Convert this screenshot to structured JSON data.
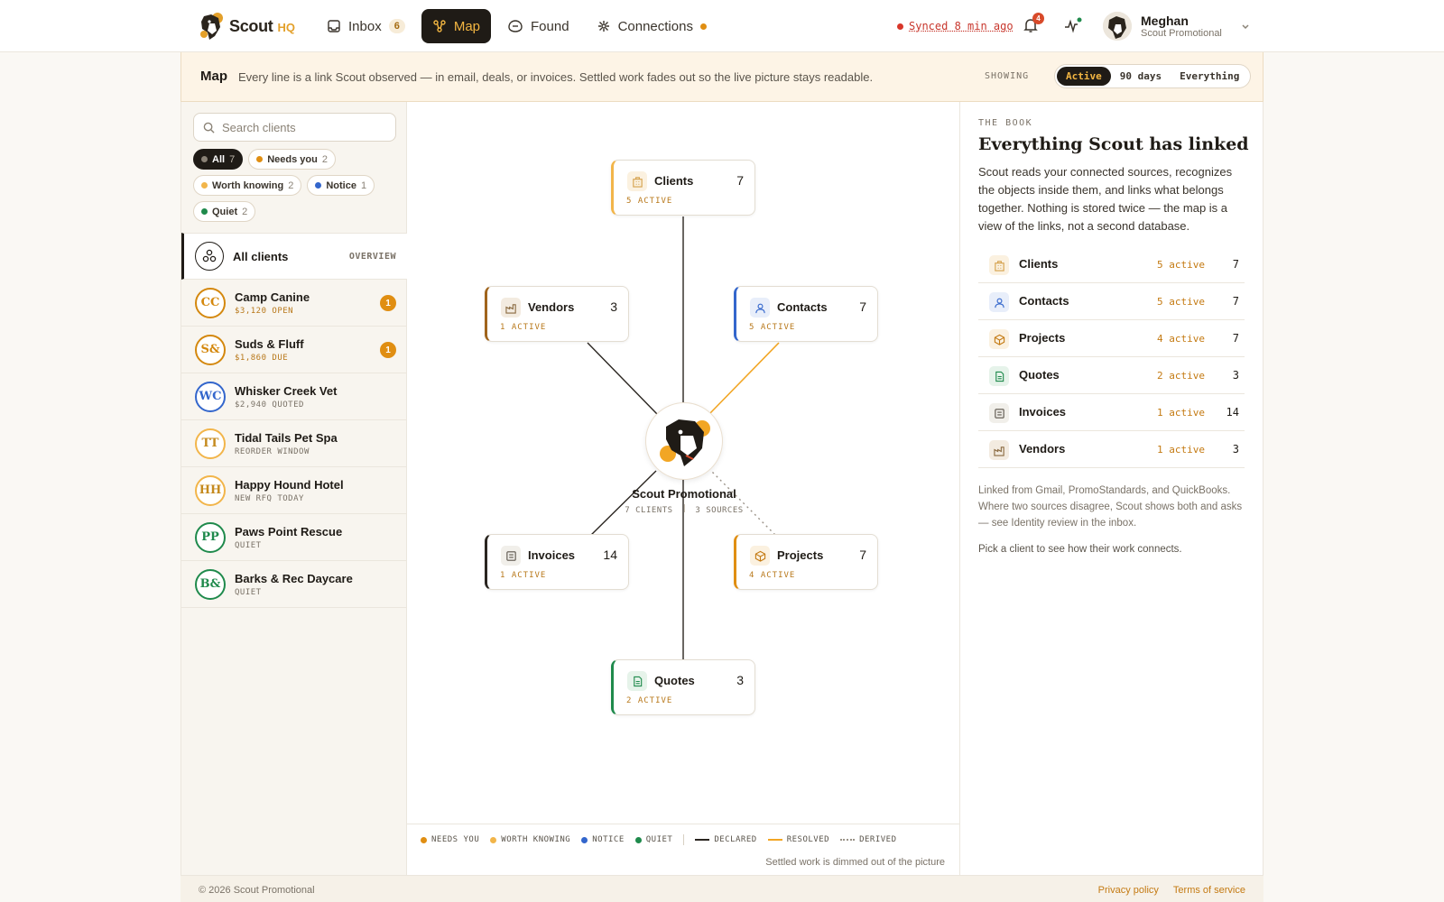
{
  "brand": {
    "name": "Scout",
    "suffix": "HQ"
  },
  "nav": {
    "inbox": {
      "label": "Inbox",
      "count": "6"
    },
    "map": {
      "label": "Map"
    },
    "found": {
      "label": "Found"
    },
    "connections": {
      "label": "Connections"
    }
  },
  "status": {
    "sync": "Synced 8 min ago",
    "notifications": "4"
  },
  "user": {
    "name": "Meghan",
    "org": "Scout Promotional"
  },
  "banner": {
    "title": "Map",
    "description": "Every line is a link Scout observed — in email, deals, or invoices. Settled work fades out so the live picture stays readable.",
    "showing_label": "SHOWING",
    "options": [
      "Active",
      "90 days",
      "Everything"
    ],
    "selected": "Active"
  },
  "sidebar": {
    "search_placeholder": "Search clients",
    "filters": [
      {
        "label": "All",
        "count": "7",
        "color": "#8a8276"
      },
      {
        "label": "Needs you",
        "count": "2",
        "color": "#e08e12"
      },
      {
        "label": "Worth knowing",
        "count": "2",
        "color": "#f2b54a"
      },
      {
        "label": "Notice",
        "count": "1",
        "color": "#3366cc"
      },
      {
        "label": "Quiet",
        "count": "2",
        "color": "#1f8a4c"
      }
    ],
    "all_clients": {
      "label": "All clients",
      "tag": "OVERVIEW"
    },
    "clients": [
      {
        "initials": "CC",
        "name": "Camp Canine",
        "sub": "$3,120 OPEN",
        "badge": "1",
        "color": "#d4880e"
      },
      {
        "initials": "S&",
        "name": "Suds & Fluff",
        "sub": "$1,860 DUE",
        "badge": "1",
        "color": "#d4880e"
      },
      {
        "initials": "WC",
        "name": "Whisker Creek Vet",
        "sub": "$2,940 QUOTED",
        "badge": "",
        "color": "#3366cc"
      },
      {
        "initials": "TT",
        "name": "Tidal Tails Pet Spa",
        "sub": "REORDER WINDOW",
        "badge": "",
        "color": "#f2b54a"
      },
      {
        "initials": "HH",
        "name": "Happy Hound Hotel",
        "sub": "NEW RFQ TODAY",
        "badge": "",
        "color": "#f2b54a"
      },
      {
        "initials": "PP",
        "name": "Paws Point Rescue",
        "sub": "QUIET",
        "badge": "",
        "color": "#1f8a4c"
      },
      {
        "initials": "B&",
        "name": "Barks & Rec Daycare",
        "sub": "QUIET",
        "badge": "",
        "color": "#1f8a4c"
      }
    ]
  },
  "map": {
    "center": {
      "name": "Scout Promotional",
      "clients": "7 CLIENTS",
      "sources": "3 SOURCES"
    },
    "nodes": {
      "clients": {
        "name": "Clients",
        "count": "7",
        "active": "5 ACTIVE",
        "color": "#f2b54a"
      },
      "vendors": {
        "name": "Vendors",
        "count": "3",
        "active": "1 ACTIVE",
        "color": "#a0641c"
      },
      "contacts": {
        "name": "Contacts",
        "count": "7",
        "active": "5 ACTIVE",
        "color": "#3366cc"
      },
      "invoices": {
        "name": "Invoices",
        "count": "14",
        "active": "1 ACTIVE",
        "color": "#2a2520"
      },
      "projects": {
        "name": "Projects",
        "count": "7",
        "active": "4 ACTIVE",
        "color": "#e08e12"
      },
      "quotes": {
        "name": "Quotes",
        "count": "3",
        "active": "2 ACTIVE",
        "color": "#1f8a4c"
      }
    },
    "legend": {
      "needs_you": "NEEDS YOU",
      "worth_knowing": "WORTH KNOWING",
      "notice": "NOTICE",
      "quiet": "QUIET",
      "declared": "DECLARED",
      "resolved": "RESOLVED",
      "derived": "DERIVED",
      "note": "Settled work is dimmed out of the picture"
    }
  },
  "book": {
    "eyebrow": "THE BOOK",
    "title": "Everything Scout has linked",
    "description": "Scout reads your connected sources, recognizes the objects inside them, and links what belongs together. Nothing is stored twice — the map is a view of the links, not a second database.",
    "rows": [
      {
        "name": "Clients",
        "active": "5 active",
        "count": "7"
      },
      {
        "name": "Contacts",
        "active": "5 active",
        "count": "7"
      },
      {
        "name": "Projects",
        "active": "4 active",
        "count": "7"
      },
      {
        "name": "Quotes",
        "active": "2 active",
        "count": "3"
      },
      {
        "name": "Invoices",
        "active": "1 active",
        "count": "14"
      },
      {
        "name": "Vendors",
        "active": "1 active",
        "count": "3"
      }
    ],
    "note": "Linked from Gmail, PromoStandards, and QuickBooks. Where two sources disagree, Scout shows both and asks — see Identity review in the inbox.",
    "hint": "Pick a client to see how their work connects."
  },
  "footer": {
    "copyright": "© 2026 Scout Promotional",
    "privacy": "Privacy policy",
    "terms": "Terms of service"
  },
  "colors": {
    "accent": "#f3b642",
    "dark": "#1f1b16",
    "needs_you": "#e08e12",
    "worth_knowing": "#f2b54a",
    "notice": "#3366cc",
    "quiet": "#1f8a4c"
  }
}
